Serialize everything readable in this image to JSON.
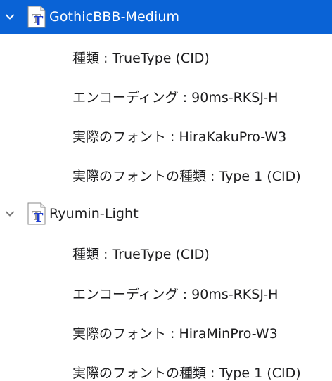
{
  "fonts": [
    {
      "name": "GothicBBB-Medium",
      "expanded": true,
      "selected": true,
      "details": [
        "種類 : TrueType (CID)",
        "エンコーディング : 90ms-RKSJ-H",
        "実際のフォント : HiraKakuPro-W3",
        "実際のフォントの種類 : Type 1 (CID)"
      ]
    },
    {
      "name": "Ryumin-Light",
      "expanded": true,
      "selected": false,
      "details": [
        "種類 : TrueType (CID)",
        "エンコーディング : 90ms-RKSJ-H",
        "実際のフォント : HiraMinPro-W3",
        "実際のフォントの種類 : Type 1 (CID)"
      ]
    }
  ],
  "icons": {
    "disclosure": "chevron-down-icon",
    "font_file": "truetype-font-file-icon"
  },
  "colors": {
    "selection": "#0a63d6",
    "icon_letter": "#1f3fd0"
  }
}
